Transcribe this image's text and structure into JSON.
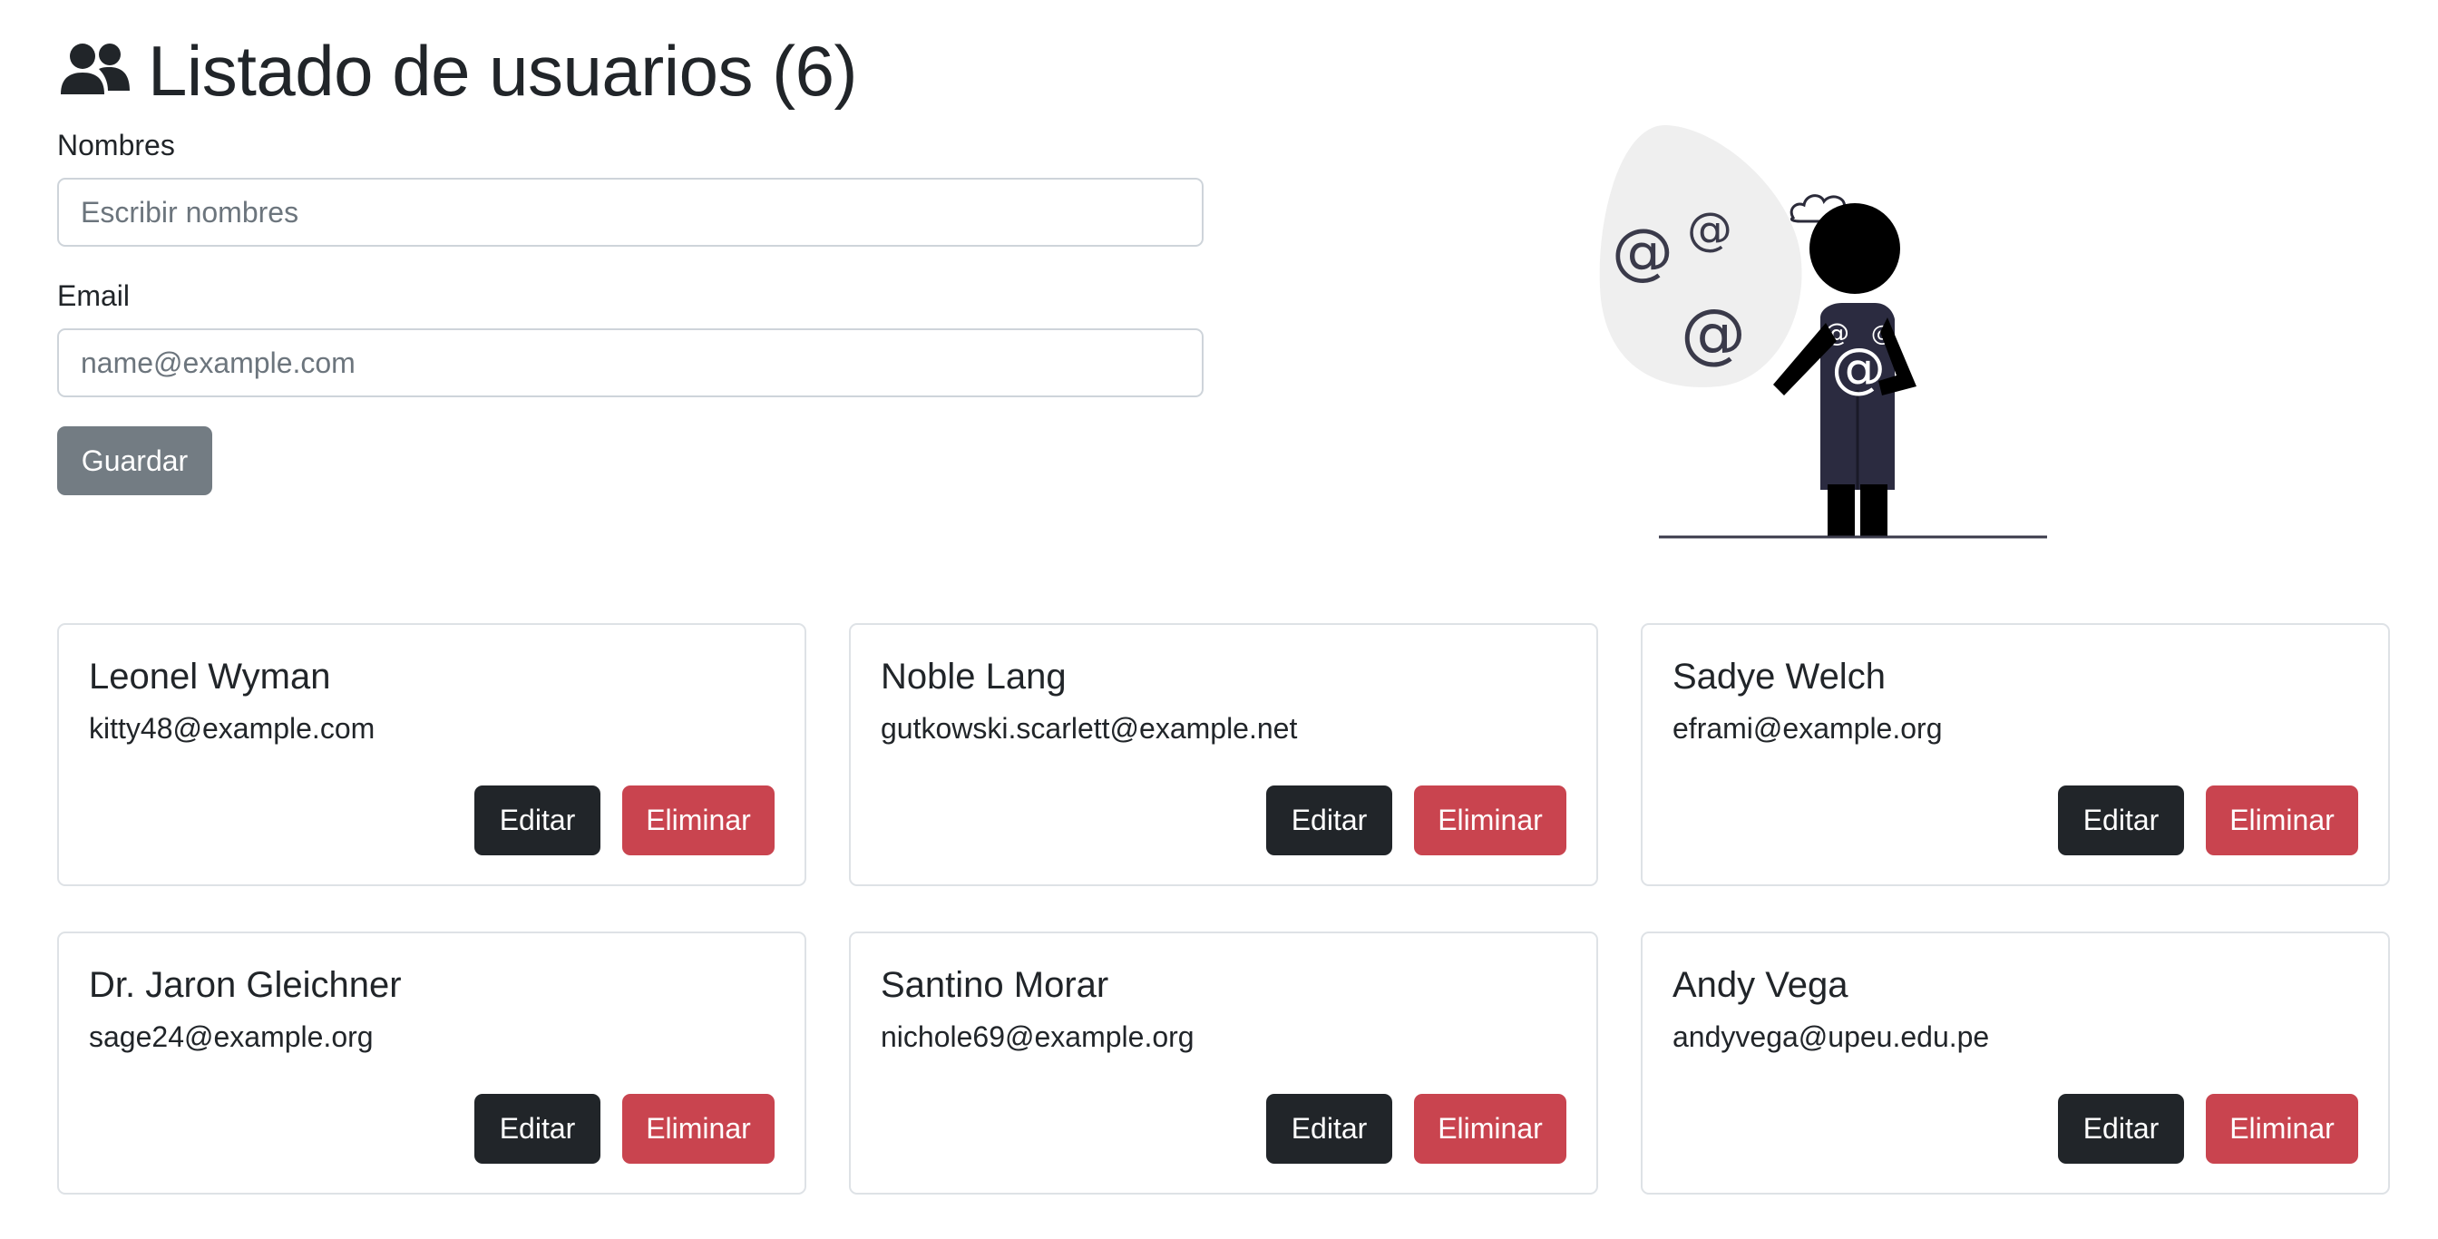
{
  "header": {
    "title": "Listado de usuarios (6)",
    "icon": "users-icon"
  },
  "form": {
    "names_label": "Nombres",
    "names_placeholder": "Escribir nombres",
    "names_value": "",
    "email_label": "Email",
    "email_placeholder": "name@example.com",
    "email_value": "",
    "save_label": "Guardar"
  },
  "illustration": {
    "name": "email-person-illustration"
  },
  "users": [
    {
      "name": "Leonel Wyman",
      "email": "kitty48@example.com",
      "edit_label": "Editar",
      "delete_label": "Eliminar"
    },
    {
      "name": "Noble Lang",
      "email": "gutkowski.scarlett@example.net",
      "edit_label": "Editar",
      "delete_label": "Eliminar"
    },
    {
      "name": "Sadye Welch",
      "email": "eframi@example.org",
      "edit_label": "Editar",
      "delete_label": "Eliminar"
    },
    {
      "name": "Dr. Jaron Gleichner",
      "email": "sage24@example.org",
      "edit_label": "Editar",
      "delete_label": "Eliminar"
    },
    {
      "name": "Santino Morar",
      "email": "nichole69@example.org",
      "edit_label": "Editar",
      "delete_label": "Eliminar"
    },
    {
      "name": "Andy Vega",
      "email": "andyvega@upeu.edu.pe",
      "edit_label": "Editar",
      "delete_label": "Eliminar"
    }
  ],
  "colors": {
    "dark_button": "#212529",
    "danger_button": "#c9444f",
    "secondary_button": "#6c757d",
    "card_border": "#dee2e6"
  }
}
